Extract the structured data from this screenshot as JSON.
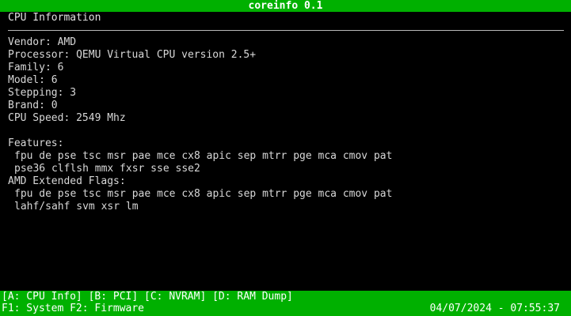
{
  "app": {
    "title": "coreinfo 0.1"
  },
  "section_title": "CPU Information",
  "cpu": {
    "vendor": "Vendor: AMD",
    "processor": "Processor: QEMU Virtual CPU version 2.5+",
    "family": "Family: 6",
    "model": "Model: 6",
    "stepping": "Stepping: 3",
    "brand": "Brand: 0",
    "speed": "CPU Speed: 2549 Mhz"
  },
  "features": {
    "heading": "Features:",
    "lines": [
      "fpu de pse tsc msr pae mce cx8 apic sep mtrr pge mca cmov pat",
      "pse36 clflsh mmx fxsr sse sse2"
    ]
  },
  "amd_features": {
    "heading": "AMD Extended Flags:",
    "lines": [
      "fpu de pse tsc msr pae mce cx8 apic sep mtrr pge mca cmov pat",
      "lahf/sahf svm xsr lm"
    ]
  },
  "menu": {
    "line": "[A: CPU Info] [B: PCI] [C: NVRAM] [D: RAM Dump]",
    "fkeys": "F1: System F2: Firmware"
  },
  "status": {
    "datetime": "04/07/2024 - 07:55:37"
  },
  "colors": {
    "bar": "#00b000",
    "text": "#d8d8d8",
    "background": "#000000"
  }
}
